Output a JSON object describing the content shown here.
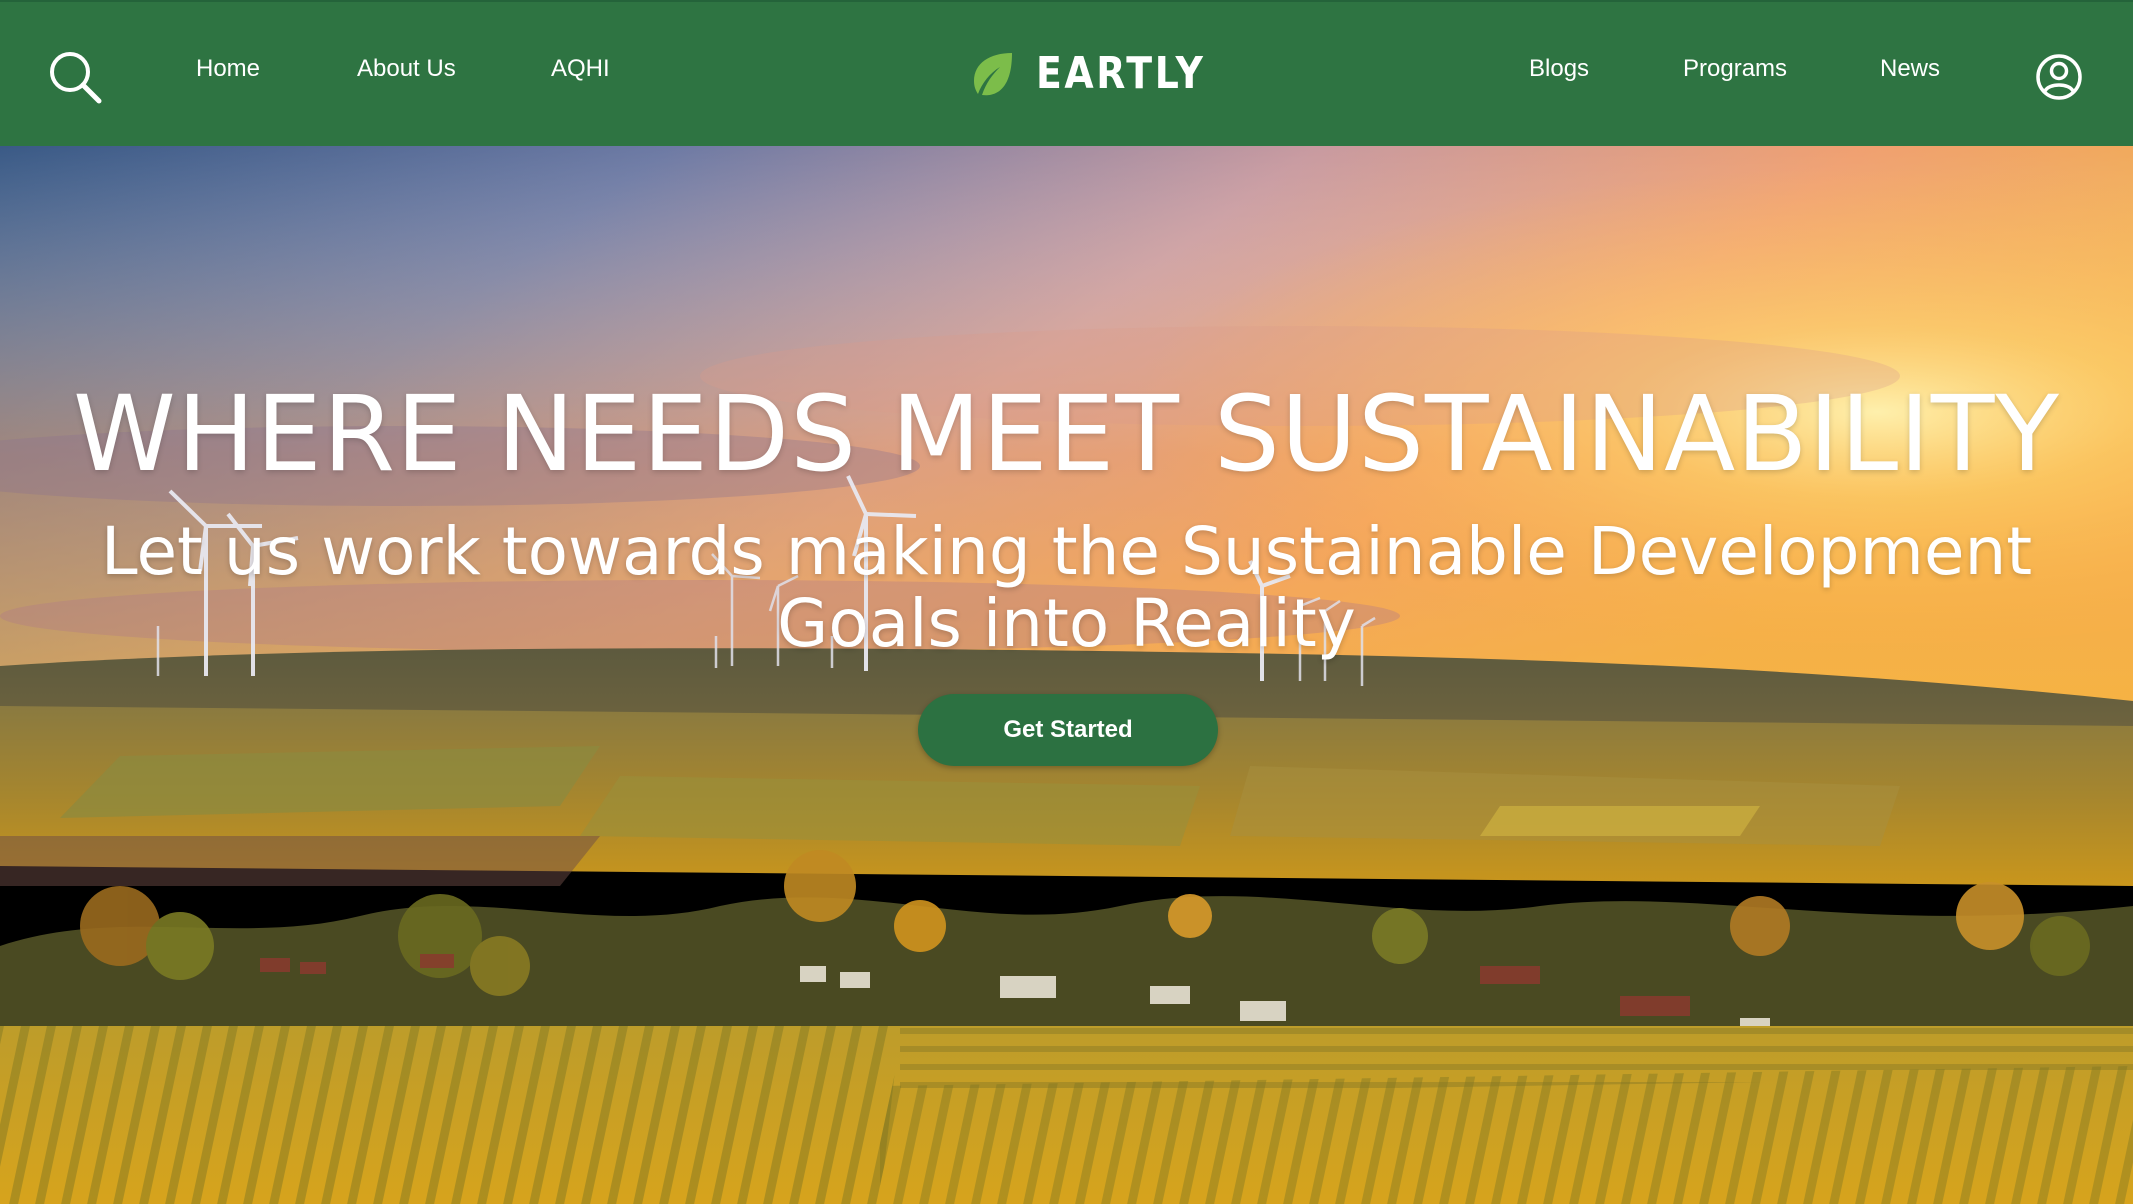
{
  "nav": {
    "search_icon": "search-icon",
    "links_left": [
      "Home",
      "About Us",
      "AQHI"
    ],
    "brand": {
      "name": "EARTLY",
      "icon": "leaf-icon",
      "icon_color": "#7cbd4a"
    },
    "links_right": [
      "Blogs",
      "Programs",
      "News"
    ],
    "user_icon": "user-circle-icon",
    "background": "#2e7442"
  },
  "hero": {
    "title": "WHERE NEEDS MEET SUSTAINABILITY",
    "subtitle": "Let us work towards making the Sustainable Development Goals into Reality",
    "cta_label": "Get Started",
    "cta_color": "#2c7141",
    "background_image": "sunset-wind-farm-vineyard-landscape"
  }
}
